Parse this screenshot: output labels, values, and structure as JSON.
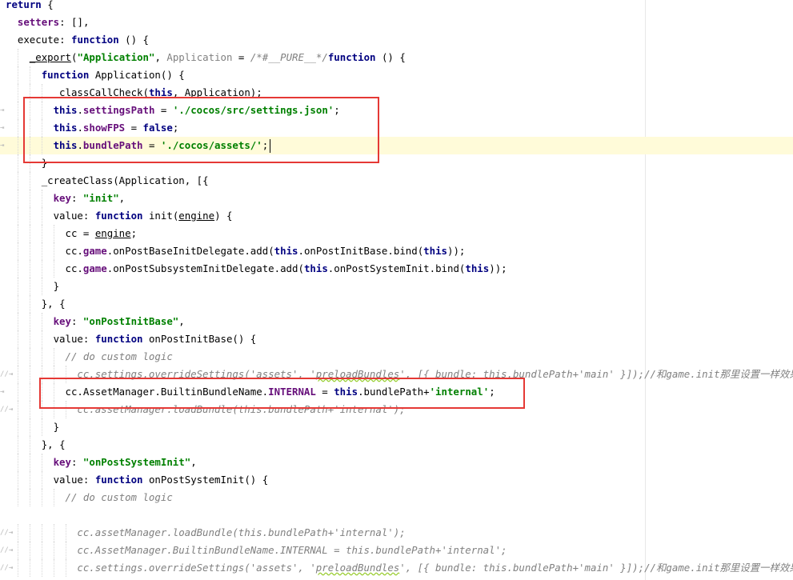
{
  "editor": {
    "language": "javascript",
    "current_line": 8,
    "lines": [
      {
        "indent": 0,
        "gutter": "",
        "tokens": [
          [
            "kw",
            "return"
          ],
          [
            "punc",
            " {"
          ]
        ]
      },
      {
        "indent": 2,
        "gutter": "",
        "tokens": [
          [
            "prop",
            "setters"
          ],
          [
            "punc",
            ": [],"
          ]
        ]
      },
      {
        "indent": 2,
        "gutter": "",
        "tokens": [
          [
            "fn",
            "execute"
          ],
          [
            "punc",
            ": "
          ],
          [
            "kw",
            "function"
          ],
          [
            "punc",
            " () {"
          ]
        ]
      },
      {
        "indent": 4,
        "gutter": "",
        "tokens": [
          [
            "fn ul",
            "_export"
          ],
          [
            "punc",
            "("
          ],
          [
            "str",
            "\"Application\""
          ],
          [
            "punc",
            ", "
          ],
          [
            "grey",
            "Application"
          ],
          [
            "punc",
            " = "
          ],
          [
            "cmt",
            "/*#__PURE__*/"
          ],
          [
            "kw",
            "function"
          ],
          [
            "punc",
            " () {"
          ]
        ]
      },
      {
        "indent": 6,
        "gutter": "",
        "tokens": [
          [
            "kw",
            "function"
          ],
          [
            "fn",
            " Application"
          ],
          [
            "punc",
            "() {"
          ]
        ]
      },
      {
        "indent": 8,
        "gutter": "",
        "tokens": [
          [
            "fn",
            "_classCallCheck"
          ],
          [
            "punc",
            "("
          ],
          [
            "kw",
            "this"
          ],
          [
            "punc",
            ", Application);"
          ]
        ]
      },
      {
        "indent": 8,
        "gutter": "⇥",
        "tokens": [
          [
            "kw",
            "this"
          ],
          [
            "punc",
            "."
          ],
          [
            "prop",
            "settingsPath"
          ],
          [
            "punc",
            " = "
          ],
          [
            "str",
            "'./cocos/src/settings.json'"
          ],
          [
            "punc",
            ";"
          ]
        ]
      },
      {
        "indent": 8,
        "gutter": "⇥",
        "tokens": [
          [
            "kw",
            "this"
          ],
          [
            "punc",
            "."
          ],
          [
            "prop",
            "showFPS"
          ],
          [
            "punc",
            " = "
          ],
          [
            "kw",
            "false"
          ],
          [
            "punc",
            ";"
          ]
        ]
      },
      {
        "indent": 8,
        "gutter": "⇥",
        "tokens": [
          [
            "kw",
            "this"
          ],
          [
            "punc",
            "."
          ],
          [
            "prop",
            "bundlePath"
          ],
          [
            "punc",
            " = "
          ],
          [
            "str",
            "'./cocos/assets/'"
          ],
          [
            "punc",
            ";"
          ]
        ],
        "caret": true
      },
      {
        "indent": 6,
        "gutter": "",
        "tokens": [
          [
            "punc",
            "}"
          ]
        ]
      },
      {
        "indent": 6,
        "gutter": "",
        "tokens": [
          [
            "fn",
            "_createClass"
          ],
          [
            "punc",
            "(Application, [{"
          ]
        ]
      },
      {
        "indent": 8,
        "gutter": "",
        "tokens": [
          [
            "prop",
            "key"
          ],
          [
            "punc",
            ": "
          ],
          [
            "str",
            "\"init\""
          ],
          [
            "punc",
            ","
          ]
        ]
      },
      {
        "indent": 8,
        "gutter": "",
        "tokens": [
          [
            "fn",
            "value"
          ],
          [
            "punc",
            ": "
          ],
          [
            "kw",
            "function"
          ],
          [
            "fn",
            " init"
          ],
          [
            "punc",
            "("
          ],
          [
            "fn ul",
            "engine"
          ],
          [
            "punc",
            ") {"
          ]
        ]
      },
      {
        "indent": 10,
        "gutter": "",
        "tokens": [
          [
            "fn",
            "cc"
          ],
          [
            "punc",
            " = "
          ],
          [
            "fn ul",
            "engine"
          ],
          [
            "punc",
            ";"
          ]
        ]
      },
      {
        "indent": 10,
        "gutter": "",
        "tokens": [
          [
            "fn",
            "cc."
          ],
          [
            "prop",
            "game"
          ],
          [
            "punc",
            "."
          ],
          [
            "fn",
            "onPostBaseInitDelegate"
          ],
          [
            "punc",
            "."
          ],
          [
            "fn",
            "add"
          ],
          [
            "punc",
            "("
          ],
          [
            "kw",
            "this"
          ],
          [
            "punc",
            ".onPostInitBase."
          ],
          [
            "fn",
            "bind"
          ],
          [
            "punc",
            "("
          ],
          [
            "kw",
            "this"
          ],
          [
            "punc",
            "));"
          ]
        ]
      },
      {
        "indent": 10,
        "gutter": "",
        "tokens": [
          [
            "fn",
            "cc."
          ],
          [
            "prop",
            "game"
          ],
          [
            "punc",
            "."
          ],
          [
            "fn",
            "onPostSubsystemInitDelegate"
          ],
          [
            "punc",
            "."
          ],
          [
            "fn",
            "add"
          ],
          [
            "punc",
            "("
          ],
          [
            "kw",
            "this"
          ],
          [
            "punc",
            ".onPostSystemInit."
          ],
          [
            "fn",
            "bind"
          ],
          [
            "punc",
            "("
          ],
          [
            "kw",
            "this"
          ],
          [
            "punc",
            "));"
          ]
        ]
      },
      {
        "indent": 8,
        "gutter": "",
        "tokens": [
          [
            "punc",
            "}"
          ]
        ]
      },
      {
        "indent": 6,
        "gutter": "",
        "tokens": [
          [
            "punc",
            "}, {"
          ]
        ]
      },
      {
        "indent": 8,
        "gutter": "",
        "tokens": [
          [
            "prop",
            "key"
          ],
          [
            "punc",
            ": "
          ],
          [
            "str",
            "\"onPostInitBase\""
          ],
          [
            "punc",
            ","
          ]
        ]
      },
      {
        "indent": 8,
        "gutter": "",
        "tokens": [
          [
            "fn",
            "value"
          ],
          [
            "punc",
            ": "
          ],
          [
            "kw",
            "function"
          ],
          [
            "fn",
            " onPostInitBase"
          ],
          [
            "punc",
            "() {"
          ]
        ]
      },
      {
        "indent": 10,
        "gutter": "",
        "tokens": [
          [
            "cmt",
            "// do custom logic"
          ]
        ]
      },
      {
        "indent": 12,
        "gutter": "//⇥",
        "tokens": [
          [
            "cmt",
            "cc.settings.overrideSettings('assets', '"
          ],
          [
            "cmt typo",
            "preloadBundles"
          ],
          [
            "cmt",
            "', [{ bundle: this.bundlePath+'main' }]);//和game.init那里设置一样效果"
          ]
        ]
      },
      {
        "indent": 10,
        "gutter": "⇥",
        "tokens": [
          [
            "fn",
            "cc.AssetManager.BuiltinBundleName."
          ],
          [
            "prop",
            "INTERNAL"
          ],
          [
            "punc",
            " = "
          ],
          [
            "kw",
            "this"
          ],
          [
            "punc",
            ".bundlePath+"
          ],
          [
            "str",
            "'internal'"
          ],
          [
            "punc",
            ";"
          ]
        ]
      },
      {
        "indent": 12,
        "gutter": "//⇥",
        "tokens": [
          [
            "cmt",
            "cc.assetManager.loadBundle(this.bundlePath+'internal');"
          ]
        ]
      },
      {
        "indent": 8,
        "gutter": "",
        "tokens": [
          [
            "punc",
            "}"
          ]
        ]
      },
      {
        "indent": 6,
        "gutter": "",
        "tokens": [
          [
            "punc",
            "}, {"
          ]
        ]
      },
      {
        "indent": 8,
        "gutter": "",
        "tokens": [
          [
            "prop",
            "key"
          ],
          [
            "punc",
            ": "
          ],
          [
            "str",
            "\"onPostSystemInit\""
          ],
          [
            "punc",
            ","
          ]
        ]
      },
      {
        "indent": 8,
        "gutter": "",
        "tokens": [
          [
            "fn",
            "value"
          ],
          [
            "punc",
            ": "
          ],
          [
            "kw",
            "function"
          ],
          [
            "fn",
            " onPostSystemInit"
          ],
          [
            "punc",
            "() {"
          ]
        ]
      },
      {
        "indent": 10,
        "gutter": "",
        "tokens": [
          [
            "cmt",
            "// do custom logic"
          ]
        ]
      },
      {
        "indent": 0,
        "gutter": "",
        "tokens": []
      },
      {
        "indent": 12,
        "gutter": "//⇥",
        "tokens": [
          [
            "cmt",
            "cc.assetManager.loadBundle(this.bundlePath+'internal');"
          ]
        ]
      },
      {
        "indent": 12,
        "gutter": "//⇥",
        "tokens": [
          [
            "cmt",
            "cc.AssetManager.BuiltinBundleName.INTERNAL = this.bundlePath+'internal';"
          ]
        ]
      },
      {
        "indent": 12,
        "gutter": "//⇥",
        "tokens": [
          [
            "cmt",
            "cc.settings.overrideSettings('assets', '"
          ],
          [
            "cmt typo",
            "preloadBundles"
          ],
          [
            "cmt",
            "', [{ bundle: this.bundlePath+'main' }]);//和game.init那里设置一样效果"
          ]
        ]
      }
    ]
  },
  "annotations": {
    "box_color": "#e53935"
  }
}
